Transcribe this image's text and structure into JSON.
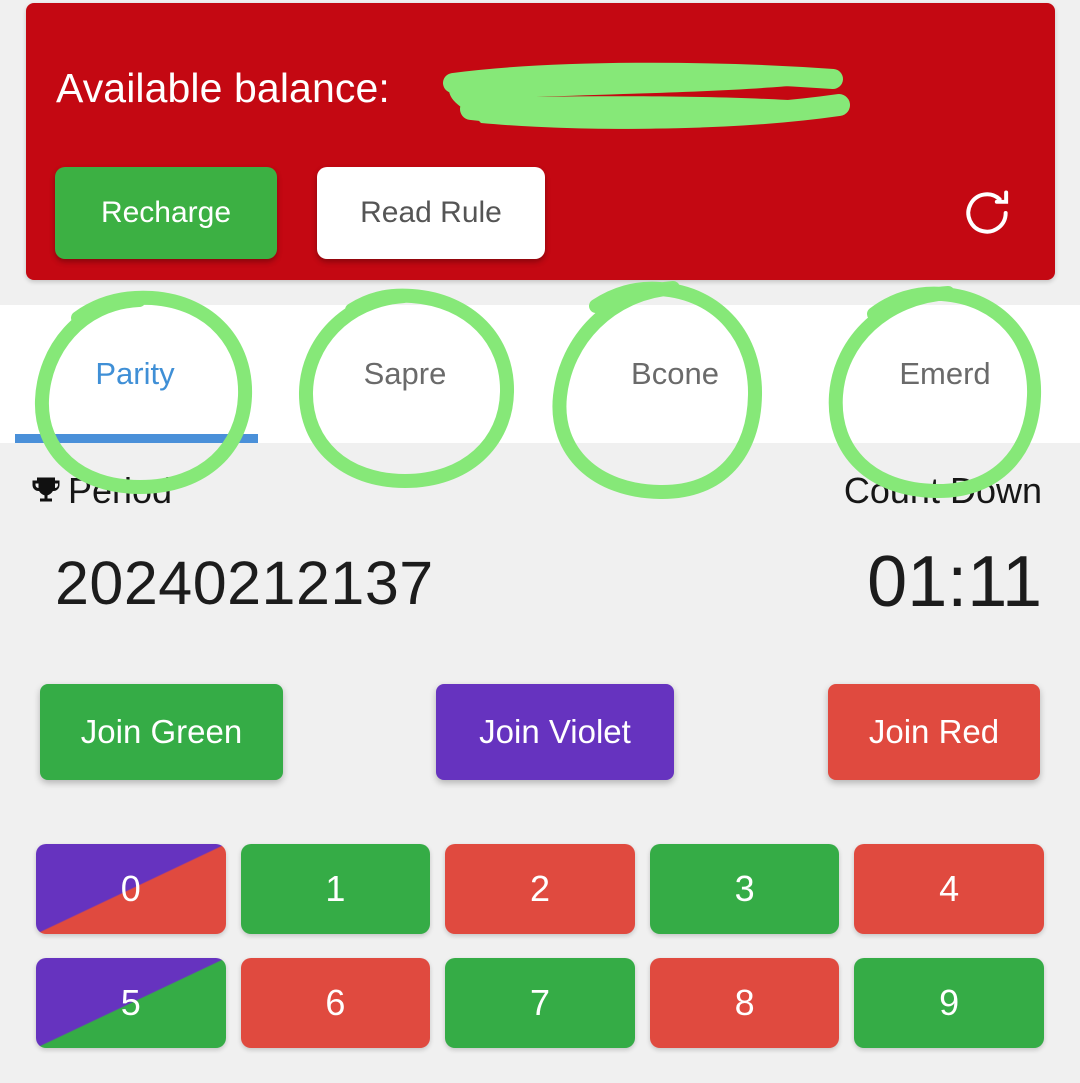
{
  "balance": {
    "label": "Available balance:",
    "value": "",
    "redacted": true,
    "recharge_label": "Recharge",
    "read_rule_label": "Read Rule",
    "refresh_icon": "refresh-icon",
    "card_color": "#c40812"
  },
  "tabs": [
    {
      "label": "Parity",
      "active": true
    },
    {
      "label": "Sapre",
      "active": false
    },
    {
      "label": "Bcone",
      "active": false
    },
    {
      "label": "Emerd",
      "active": false
    }
  ],
  "info": {
    "period_icon": "trophy-icon",
    "period_label": "Period",
    "period_value": "20240212137",
    "countdown_label": "Count Down",
    "countdown_value": "01:11"
  },
  "join_buttons": [
    {
      "label": "Join Green",
      "color": "#35ac46"
    },
    {
      "label": "Join Violet",
      "color": "#6633bf"
    },
    {
      "label": "Join Red",
      "color": "#e04a3f"
    }
  ],
  "number_rows": [
    [
      {
        "label": "0",
        "style": "violet-red"
      },
      {
        "label": "1",
        "style": "green"
      },
      {
        "label": "2",
        "style": "red"
      },
      {
        "label": "3",
        "style": "green"
      },
      {
        "label": "4",
        "style": "red"
      }
    ],
    [
      {
        "label": "5",
        "style": "violet-green"
      },
      {
        "label": "6",
        "style": "red"
      },
      {
        "label": "7",
        "style": "green"
      },
      {
        "label": "8",
        "style": "red"
      },
      {
        "label": "9",
        "style": "green"
      }
    ]
  ],
  "colors": {
    "banner_red": "#c40812",
    "green": "#35ac46",
    "violet": "#6633bf",
    "red": "#e04a3f",
    "active_tab_blue": "#3f8fd6",
    "annotation_green": "#86e878",
    "page_background": "#f0f0f0"
  }
}
